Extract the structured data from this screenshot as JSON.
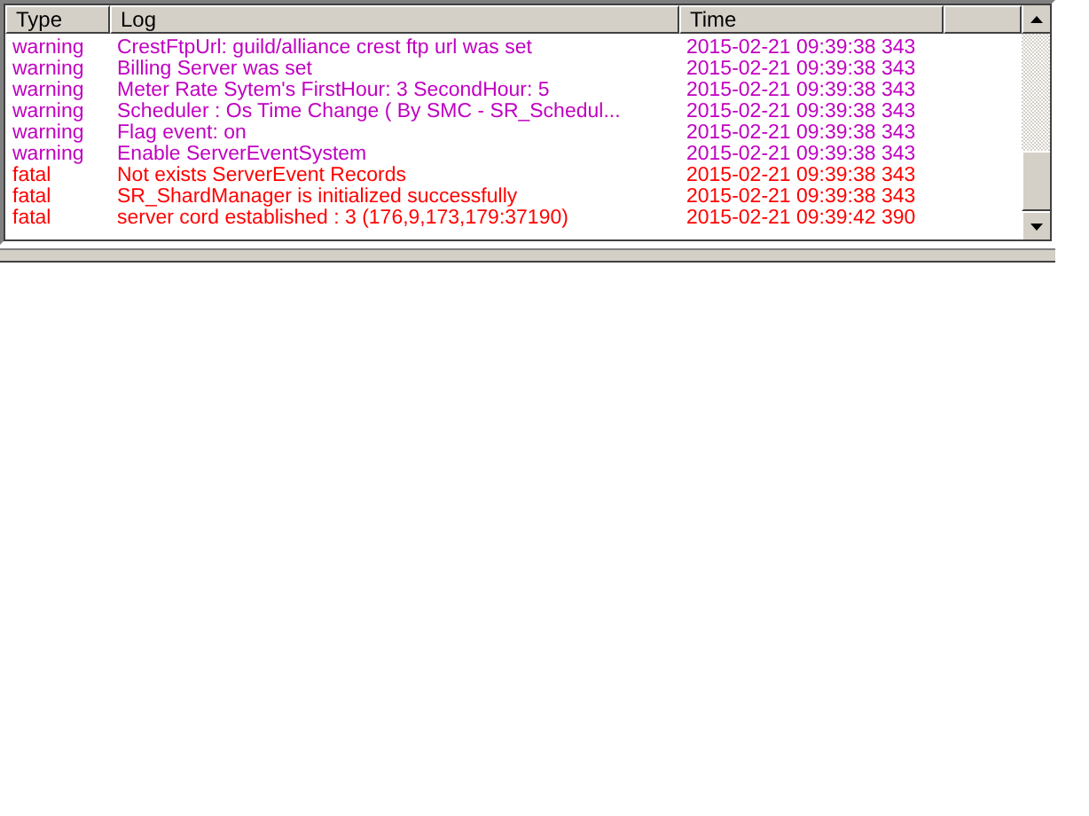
{
  "table": {
    "columns": [
      "Type",
      "Log",
      "Time"
    ],
    "rows": [
      {
        "type": "warning",
        "log": "CrestFtpUrl: guild/alliance crest ftp url was set",
        "time": "2015-02-21 09:39:38 343",
        "color": "#c000c0"
      },
      {
        "type": "warning",
        "log": "Billing Server was set",
        "time": "2015-02-21 09:39:38 343",
        "color": "#c000c0"
      },
      {
        "type": "warning",
        "log": "Meter Rate Sytem's FirstHour: 3 SecondHour: 5",
        "time": "2015-02-21 09:39:38 343",
        "color": "#c000c0"
      },
      {
        "type": "warning",
        "log": "Scheduler : Os Time Change ( By SMC - SR_Schedul...",
        "time": "2015-02-21 09:39:38 343",
        "color": "#c000c0"
      },
      {
        "type": "warning",
        "log": "Flag event: on",
        "time": "2015-02-21 09:39:38 343",
        "color": "#c000c0"
      },
      {
        "type": "warning",
        "log": "Enable ServerEventSystem",
        "time": "2015-02-21 09:39:38 343",
        "color": "#c000c0"
      },
      {
        "type": "fatal",
        "log": "Not exists ServerEvent Records",
        "time": "2015-02-21 09:39:38 343",
        "color": "#ff0000"
      },
      {
        "type": "fatal",
        "log": "SR_ShardManager is initialized successfully",
        "time": "2015-02-21 09:39:38 343",
        "color": "#ff0000"
      },
      {
        "type": "fatal",
        "log": "server cord established : 3 (176,9,173,179:37190)",
        "time": "2015-02-21 09:39:42 390",
        "color": "#ff0000"
      }
    ]
  }
}
